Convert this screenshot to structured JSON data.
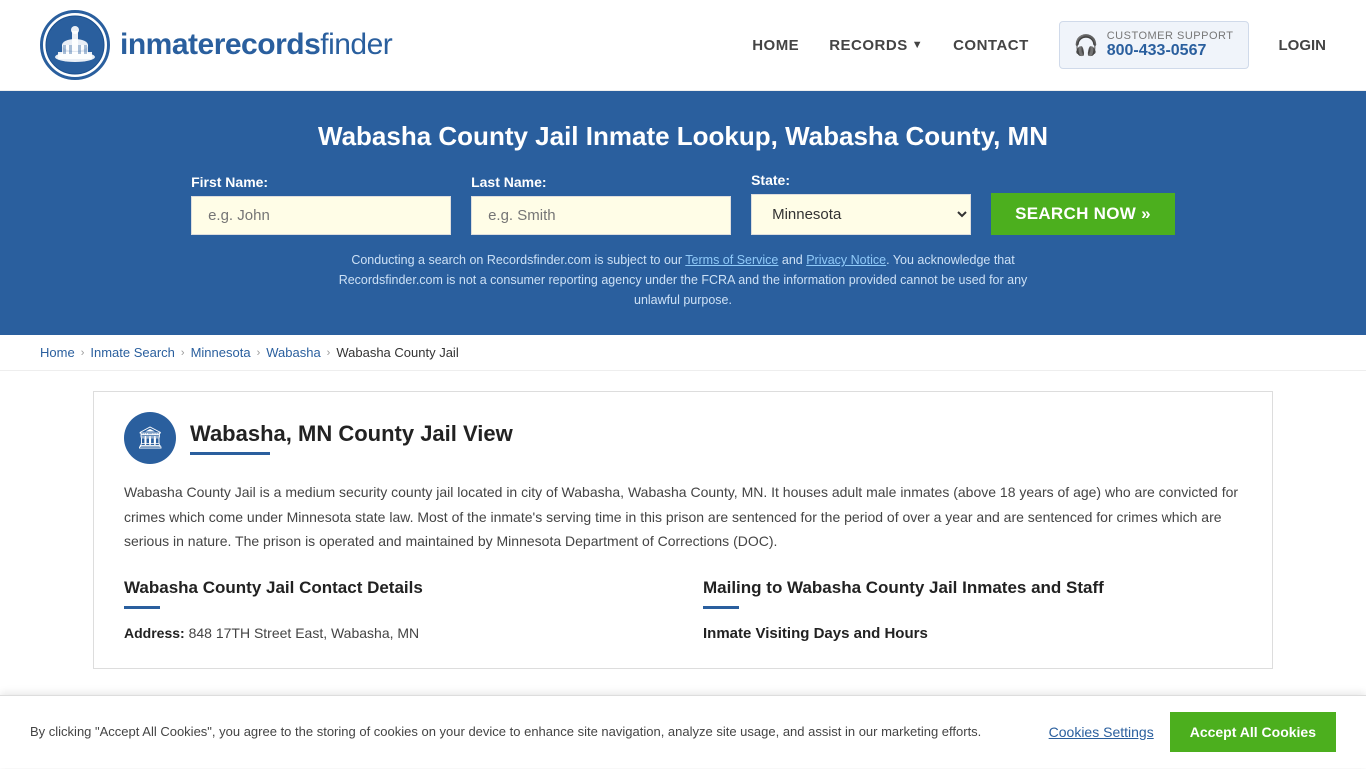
{
  "header": {
    "logo_text_main": "inmaterecords",
    "logo_text_bold": "finder",
    "nav": {
      "home": "HOME",
      "records": "RECORDS",
      "contact": "CONTACT",
      "support_label": "CUSTOMER SUPPORT",
      "support_phone": "800-433-0567",
      "login": "LOGIN"
    }
  },
  "hero": {
    "title": "Wabasha County Jail Inmate Lookup, Wabasha County, MN",
    "form": {
      "first_name_label": "First Name:",
      "first_name_placeholder": "e.g. John",
      "last_name_label": "Last Name:",
      "last_name_placeholder": "e.g. Smith",
      "state_label": "State:",
      "state_value": "Minnesota",
      "search_btn": "SEARCH NOW »"
    },
    "disclaimer": "Conducting a search on Recordsfinder.com is subject to our Terms of Service and Privacy Notice. You acknowledge that Recordsfinder.com is not a consumer reporting agency under the FCRA and the information provided cannot be used for any unlawful purpose."
  },
  "breadcrumb": {
    "items": [
      "Home",
      "Inmate Search",
      "Minnesota",
      "Wabasha",
      "Wabasha County Jail"
    ]
  },
  "main": {
    "section_title": "Wabasha, MN County Jail View",
    "description": "Wabasha County Jail is a medium security county jail located in city of Wabasha, Wabasha County, MN. It houses adult male inmates (above 18 years of age) who are convicted for crimes which come under Minnesota state law. Most of the inmate's serving time in this prison are sentenced for the period of over a year and are sentenced for crimes which are serious in nature. The prison is operated and maintained by Minnesota Department of Corrections (DOC).",
    "contact_heading": "Wabasha County Jail Contact Details",
    "mailing_heading": "Mailing to Wabasha County Jail Inmates and Staff",
    "visiting_heading": "Inmate Visiting Days and Hours",
    "address_label": "Address:",
    "address_value": "848 17TH Street East, Wabasha, MN"
  },
  "cookie_banner": {
    "text": "By clicking \"Accept All Cookies\", you agree to the storing of cookies on your device to enhance site navigation, analyze site usage, and assist in our marketing efforts.",
    "settings_btn": "Cookies Settings",
    "accept_btn": "Accept All Cookies"
  }
}
